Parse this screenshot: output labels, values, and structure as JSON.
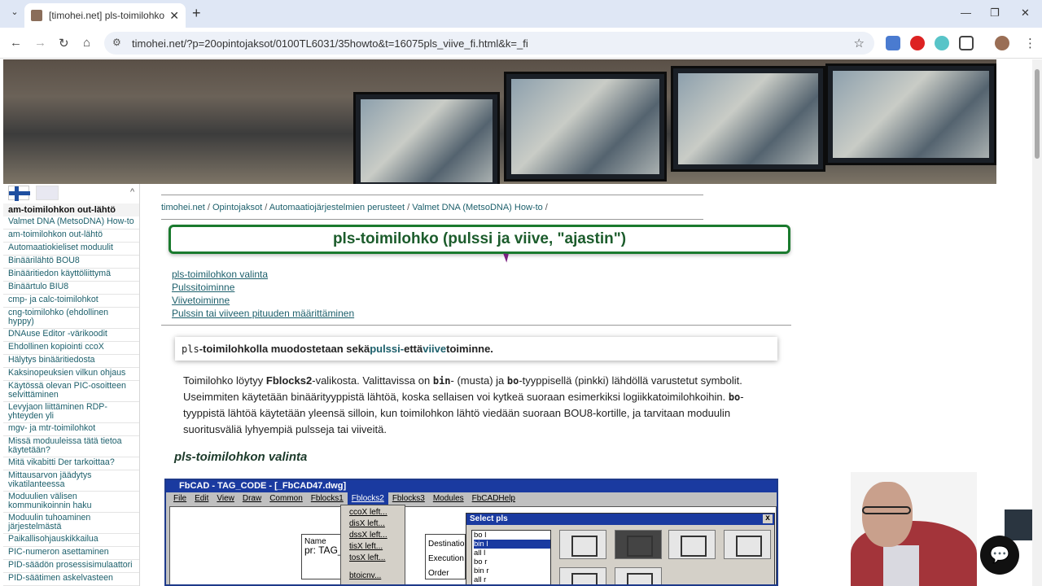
{
  "browser": {
    "tab_title": "[timohei.net] pls-toimilohko (p",
    "url": "timohei.net/?p=20opintojaksot/0100TL6031/35howto&t=16075pls_viive_fi.html&k=_fi"
  },
  "sidebar": {
    "header": "am-toimilohkon out-lähtö",
    "items": [
      "Valmet DNA (MetsoDNA) How-to",
      "am-toimilohkon out-lähtö",
      "Automaatiokieliset moduulit",
      "Binäärilähtö BOU8",
      "Binääritiedon käyttöliittymä",
      "Binäärtulo BIU8",
      "cmp- ja calc-toimilohkot",
      "cng-toimilohko (ehdollinen hyppy)",
      "DNAuse Editor -värikoodit",
      "Ehdollinen kopiointi ccoX",
      "Hälytys binääritiedosta",
      "Kaksinopeuksien vilkun ohjaus",
      "Käytössä olevan PIC-osoitteen selvittäminen",
      "Levyjaon liittäminen RDP-yhteyden yli",
      "mgv- ja mtr-toimilohkot",
      "Missä moduuleissa tätä tietoa käytetään?",
      "Mitä vikabitti Der tarkoittaa?",
      "Mittausarvon jäädytys vikatilanteessa",
      "Moduulien välisen kommunikoinnin haku",
      "Moduulin tuhoaminen järjestelmästä",
      "Paikallisohjauskikkailua",
      "PIC-numeron asettaminen",
      "PID-säädön prosessisimulaattori",
      "PID-säätimen askelvasteen"
    ]
  },
  "breadcrumb": [
    "timohei.net",
    "Opintojaksot",
    "Automaatiojärjestelmien perusteet",
    "Valmet DNA (MetsoDNA) How-to"
  ],
  "page_title": "pls-toimilohko (pulssi ja viive, \"ajastin\")",
  "toc": [
    "pls-toimilohkon valinta",
    "Pulssitoiminne",
    "Viivetoiminne",
    "Pulssin tai viiveen pituuden määrittäminen"
  ],
  "intro": {
    "code": "pls",
    "text1": "-toimilohkolla muodostetaan sekä ",
    "link1": "pulssi-",
    "text2": " että ",
    "link2": "viive",
    "text3": "toiminne."
  },
  "para": {
    "t1": "Toimilohko löytyy ",
    "b1": "Fblocks2",
    "t2": "-valikosta. Valittavissa on ",
    "c1": "bin",
    "t3": "- (musta) ja ",
    "c2": "bo",
    "t4": "-tyyppisellä (pinkki) lähdöllä varustetut symbolit. Useimmiten käytetään binäärityyppistä lähtöä, koska sellaisen voi kytkeä suoraan esimerkiksi logiikkatoimilohkoihin. ",
    "c3": "bo",
    "t5": "-tyyppistä lähtöä käytetään yleensä silloin, kun toimilohkon lähtö viedään suoraan BOU8-kortille, ja tarvitaan moduulin suoritusväliä lyhyempiä pulsseja tai viiveitä."
  },
  "section_heading": "pls-toimilohkon valinta",
  "fbcad": {
    "title": "FbCAD - TAG_CODE - [_FbCAD47.dwg]",
    "menu": [
      "File",
      "Edit",
      "View",
      "Draw",
      "Common",
      "Fblocks1",
      "Fblocks2",
      "Fblocks3",
      "Modules",
      "FbCADHelp"
    ],
    "dropdown": [
      "ccoX left...",
      "disX left...",
      "dssX left...",
      "tisX left...",
      "tosX left...",
      "btoicnv..."
    ],
    "block1": [
      "Name",
      "pr: TAG_"
    ],
    "block2": [
      "Destinatio",
      "Execution",
      "Order"
    ],
    "dialog_title": "Select pls",
    "list": [
      "bo l",
      "bin l",
      "all l",
      "bo r",
      "bin r",
      "all r"
    ]
  }
}
